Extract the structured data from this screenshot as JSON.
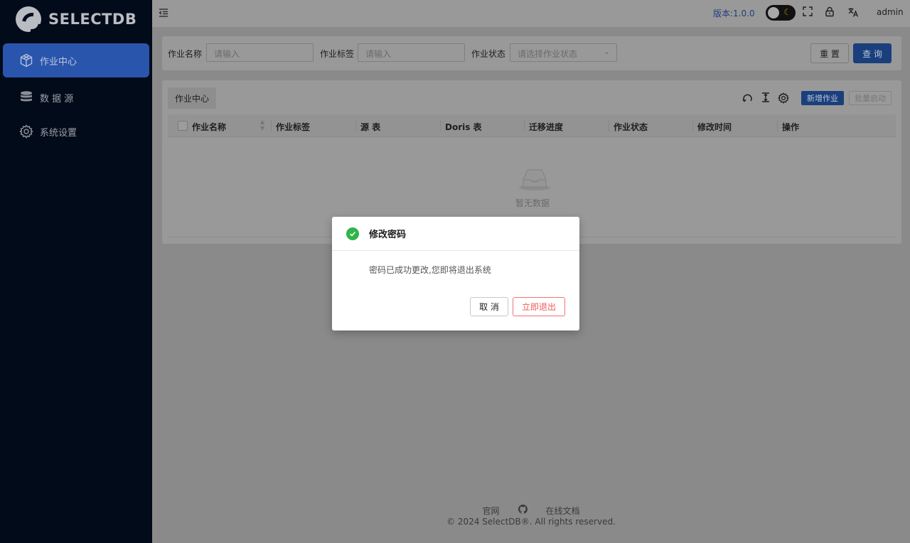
{
  "brand": {
    "name": "SELECTDB"
  },
  "sidebar": {
    "items": [
      {
        "label": "作业中心",
        "icon": "cube-icon",
        "active": true
      },
      {
        "label": "数 据 源",
        "icon": "database-icon",
        "active": false
      },
      {
        "label": "系统设置",
        "icon": "gear-icon",
        "active": false
      }
    ]
  },
  "topbar": {
    "version": "版本:1.0.0",
    "user": "admin"
  },
  "filters": {
    "name_label": "作业名称",
    "name_placeholder": "请输入",
    "tag_label": "作业标签",
    "tag_placeholder": "请输入",
    "status_label": "作业状态",
    "status_placeholder": "请选择作业状态",
    "reset_label": "重 置",
    "query_label": "查 询"
  },
  "table": {
    "tab_label": "作业中心",
    "add_label": "新增作业",
    "batch_label": "批量启动",
    "columns": [
      "作业名称",
      "作业标签",
      "源 表",
      "Doris 表",
      "迁移进度",
      "作业状态",
      "修改时间",
      "操作"
    ],
    "empty_text": "暂无数据"
  },
  "footer": {
    "link_site": "官网",
    "link_docs": "在线文档",
    "copyright": "© 2024 SelectDB®. All rights reserved."
  },
  "modal": {
    "title": "修改密码",
    "message": "密码已成功更改,您即将退出系统",
    "cancel_label": "取 消",
    "logout_label": "立即退出"
  },
  "colors": {
    "primary": "#2a55ad",
    "success": "#2fb54a",
    "danger": "#f05a5a",
    "sidebar_bg": "#020b19"
  }
}
